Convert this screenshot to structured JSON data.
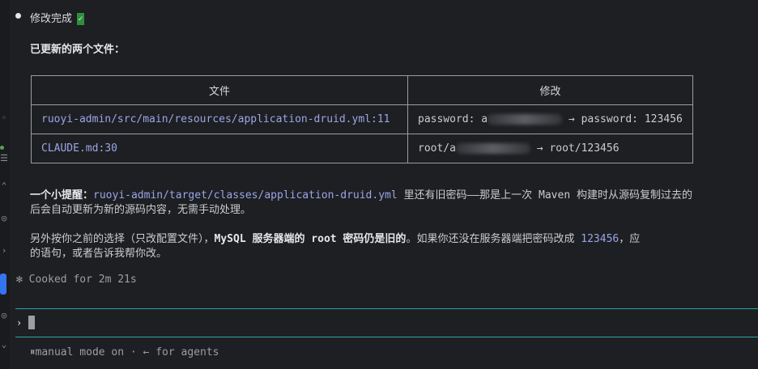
{
  "status": {
    "title": "修改完成",
    "check_icon": "check-icon"
  },
  "summary": {
    "heading": "已更新的两个文件："
  },
  "table": {
    "headers": [
      "文件",
      "修改"
    ],
    "rows": [
      {
        "file": "ruoyi-admin/src/main/resources/application-druid.yml:11",
        "change_before_prefix": "password: a",
        "change_after": " → password: 123456"
      },
      {
        "file": "CLAUDE.md:30",
        "change_before_prefix": "root/a",
        "change_after": " → root/123456"
      }
    ]
  },
  "note1": {
    "label": "一个小提醒：",
    "path": "ruoyi-admin/target/classes/application-druid.yml",
    "text": " 里还有旧密码——那是上一次 Maven 构建时从源码复制过去的",
    "line2": "后会自动更新为新的源码内容，无需手动处理。"
  },
  "note2": {
    "prefix": "另外按你之前的选择（只改配置文件），",
    "bold": "MySQL 服务器端的 root 密码仍是旧的",
    "suffix": "。如果你还没在服务器端把密码改成 ",
    "num": "123456",
    "tail": "，应",
    "line2": "的语句，或者告诉我帮你改。"
  },
  "cooked": {
    "icon": "✻",
    "text": "Cooked for 2m 21s"
  },
  "input": {
    "prompt": "›",
    "value": ""
  },
  "footer": {
    "mode_icon": "⏸",
    "text": "manual mode on · ← for agents"
  },
  "colors": {
    "background": "#1e1f22",
    "accent_line": "#2aa3a8",
    "path": "#9aa6e8",
    "success": "#2f8f3a"
  }
}
